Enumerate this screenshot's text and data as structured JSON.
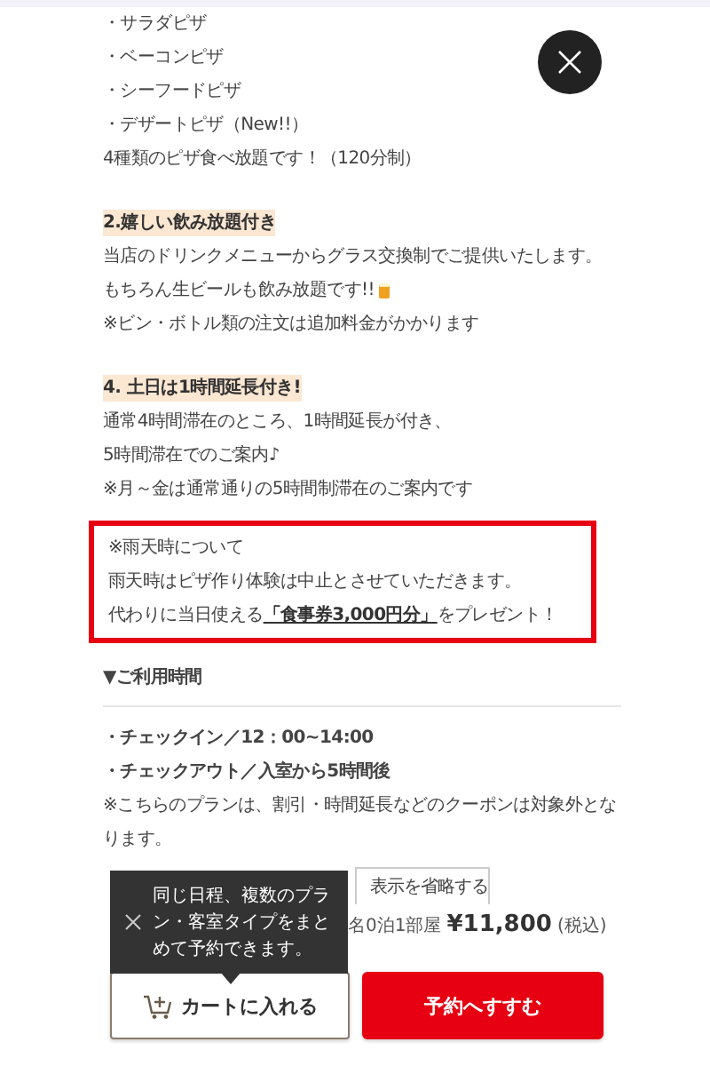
{
  "pizza_list": {
    "items": [
      "・サラダピザ",
      "・ベーコンピザ",
      "・シーフードピザ",
      "・デザートピザ（New!!）"
    ],
    "note": "4種類のピザ食べ放題です！（120分制）"
  },
  "sections": [
    {
      "heading": "2.嬉しい飲み放題付き",
      "lines": [
        {
          "text": "当店のドリンクメニューからグラス交換制でご提供いたします。"
        },
        {
          "text": "もちろん生ビールも飲み放題です!!",
          "kind": "beer"
        },
        {
          "text": "※ビン・ボトル類の注文は追加料金がかかります"
        }
      ]
    },
    {
      "heading": "4. 土日は1時間延長付き!",
      "lines": [
        {
          "text": "通常4時間滞在のところ、1時間延長が付き、"
        },
        {
          "text": "5時間滞在でのご案内♪"
        },
        {
          "text": "※月～金は通常通りの5時間制滞在のご案内です"
        }
      ]
    }
  ],
  "rain_notice": [
    "※雨天時について",
    "雨天時はピザ作り体験は中止とさせていただきます。",
    "代わりに当日使える**「食事券3,000円分」**をプレゼント！"
  ],
  "usage": {
    "heading": "▼ご利用時間",
    "items": [
      "・チェックイン／12：00~14:00",
      "・チェックアウト／入室から5時間後"
    ],
    "note": "※こちらのプランは、割引・時間延長などのクーポンは対象外となります。"
  },
  "collapse_tab": "表示を省略する",
  "price": {
    "detail": "名0泊1部屋",
    "amount": "¥11,800",
    "tax": "(税込)"
  },
  "tooltip": "同じ日程、複数のプラン・客室タイプをまとめて予約できます。",
  "buttons": {
    "cart": "カートに入れる",
    "reserve": "予約へすすむ"
  }
}
